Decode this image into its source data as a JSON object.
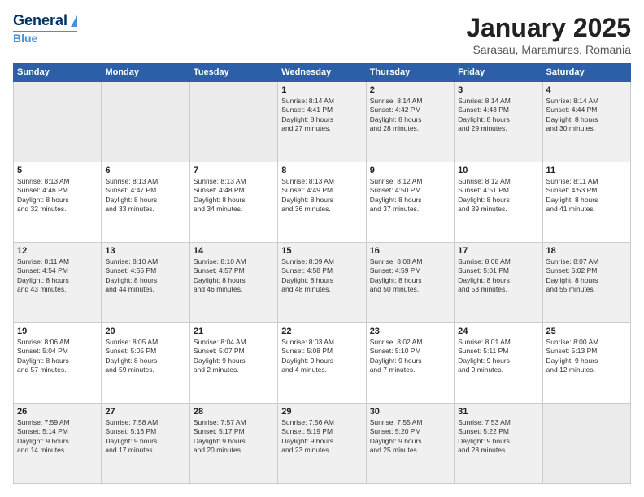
{
  "header": {
    "logo_line1": "General",
    "logo_line2": "Blue",
    "month": "January 2025",
    "location": "Sarasau, Maramures, Romania"
  },
  "weekdays": [
    "Sunday",
    "Monday",
    "Tuesday",
    "Wednesday",
    "Thursday",
    "Friday",
    "Saturday"
  ],
  "weeks": [
    [
      {
        "day": "",
        "info": ""
      },
      {
        "day": "",
        "info": ""
      },
      {
        "day": "",
        "info": ""
      },
      {
        "day": "1",
        "info": "Sunrise: 8:14 AM\nSunset: 4:41 PM\nDaylight: 8 hours\nand 27 minutes."
      },
      {
        "day": "2",
        "info": "Sunrise: 8:14 AM\nSunset: 4:42 PM\nDaylight: 8 hours\nand 28 minutes."
      },
      {
        "day": "3",
        "info": "Sunrise: 8:14 AM\nSunset: 4:43 PM\nDaylight: 8 hours\nand 29 minutes."
      },
      {
        "day": "4",
        "info": "Sunrise: 8:14 AM\nSunset: 4:44 PM\nDaylight: 8 hours\nand 30 minutes."
      }
    ],
    [
      {
        "day": "5",
        "info": "Sunrise: 8:13 AM\nSunset: 4:46 PM\nDaylight: 8 hours\nand 32 minutes."
      },
      {
        "day": "6",
        "info": "Sunrise: 8:13 AM\nSunset: 4:47 PM\nDaylight: 8 hours\nand 33 minutes."
      },
      {
        "day": "7",
        "info": "Sunrise: 8:13 AM\nSunset: 4:48 PM\nDaylight: 8 hours\nand 34 minutes."
      },
      {
        "day": "8",
        "info": "Sunrise: 8:13 AM\nSunset: 4:49 PM\nDaylight: 8 hours\nand 36 minutes."
      },
      {
        "day": "9",
        "info": "Sunrise: 8:12 AM\nSunset: 4:50 PM\nDaylight: 8 hours\nand 37 minutes."
      },
      {
        "day": "10",
        "info": "Sunrise: 8:12 AM\nSunset: 4:51 PM\nDaylight: 8 hours\nand 39 minutes."
      },
      {
        "day": "11",
        "info": "Sunrise: 8:11 AM\nSunset: 4:53 PM\nDaylight: 8 hours\nand 41 minutes."
      }
    ],
    [
      {
        "day": "12",
        "info": "Sunrise: 8:11 AM\nSunset: 4:54 PM\nDaylight: 8 hours\nand 43 minutes."
      },
      {
        "day": "13",
        "info": "Sunrise: 8:10 AM\nSunset: 4:55 PM\nDaylight: 8 hours\nand 44 minutes."
      },
      {
        "day": "14",
        "info": "Sunrise: 8:10 AM\nSunset: 4:57 PM\nDaylight: 8 hours\nand 46 minutes."
      },
      {
        "day": "15",
        "info": "Sunrise: 8:09 AM\nSunset: 4:58 PM\nDaylight: 8 hours\nand 48 minutes."
      },
      {
        "day": "16",
        "info": "Sunrise: 8:08 AM\nSunset: 4:59 PM\nDaylight: 8 hours\nand 50 minutes."
      },
      {
        "day": "17",
        "info": "Sunrise: 8:08 AM\nSunset: 5:01 PM\nDaylight: 8 hours\nand 53 minutes."
      },
      {
        "day": "18",
        "info": "Sunrise: 8:07 AM\nSunset: 5:02 PM\nDaylight: 8 hours\nand 55 minutes."
      }
    ],
    [
      {
        "day": "19",
        "info": "Sunrise: 8:06 AM\nSunset: 5:04 PM\nDaylight: 8 hours\nand 57 minutes."
      },
      {
        "day": "20",
        "info": "Sunrise: 8:05 AM\nSunset: 5:05 PM\nDaylight: 8 hours\nand 59 minutes."
      },
      {
        "day": "21",
        "info": "Sunrise: 8:04 AM\nSunset: 5:07 PM\nDaylight: 9 hours\nand 2 minutes."
      },
      {
        "day": "22",
        "info": "Sunrise: 8:03 AM\nSunset: 5:08 PM\nDaylight: 9 hours\nand 4 minutes."
      },
      {
        "day": "23",
        "info": "Sunrise: 8:02 AM\nSunset: 5:10 PM\nDaylight: 9 hours\nand 7 minutes."
      },
      {
        "day": "24",
        "info": "Sunrise: 8:01 AM\nSunset: 5:11 PM\nDaylight: 9 hours\nand 9 minutes."
      },
      {
        "day": "25",
        "info": "Sunrise: 8:00 AM\nSunset: 5:13 PM\nDaylight: 9 hours\nand 12 minutes."
      }
    ],
    [
      {
        "day": "26",
        "info": "Sunrise: 7:59 AM\nSunset: 5:14 PM\nDaylight: 9 hours\nand 14 minutes."
      },
      {
        "day": "27",
        "info": "Sunrise: 7:58 AM\nSunset: 5:16 PM\nDaylight: 9 hours\nand 17 minutes."
      },
      {
        "day": "28",
        "info": "Sunrise: 7:57 AM\nSunset: 5:17 PM\nDaylight: 9 hours\nand 20 minutes."
      },
      {
        "day": "29",
        "info": "Sunrise: 7:56 AM\nSunset: 5:19 PM\nDaylight: 9 hours\nand 23 minutes."
      },
      {
        "day": "30",
        "info": "Sunrise: 7:55 AM\nSunset: 5:20 PM\nDaylight: 9 hours\nand 25 minutes."
      },
      {
        "day": "31",
        "info": "Sunrise: 7:53 AM\nSunset: 5:22 PM\nDaylight: 9 hours\nand 28 minutes."
      },
      {
        "day": "",
        "info": ""
      }
    ]
  ]
}
